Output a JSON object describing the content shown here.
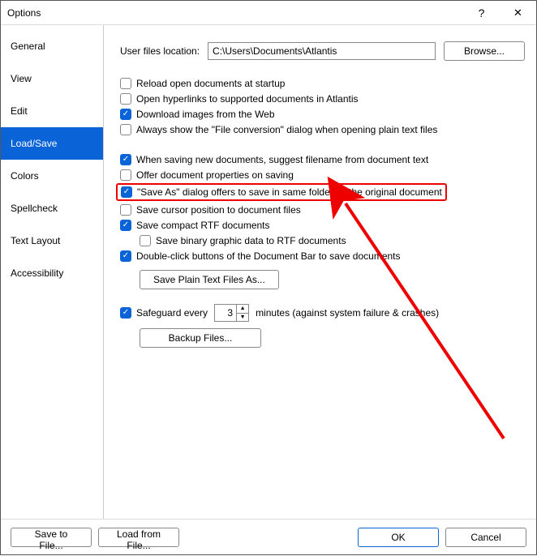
{
  "window": {
    "title": "Options"
  },
  "sidebar": {
    "tabs": [
      {
        "label": "General"
      },
      {
        "label": "View"
      },
      {
        "label": "Edit"
      },
      {
        "label": "Load/Save"
      },
      {
        "label": "Colors"
      },
      {
        "label": "Spellcheck"
      },
      {
        "label": "Text Layout"
      },
      {
        "label": "Accessibility"
      }
    ],
    "selected_index": 3
  },
  "content": {
    "files_location_label": "User files location:",
    "files_location_value": "C:\\Users\\Documents\\Atlantis",
    "browse_label": "Browse...",
    "group1": {
      "reload": "Reload open documents at startup",
      "open_hyperlinks": "Open hyperlinks to supported documents in Atlantis",
      "download_images": "Download images from the Web",
      "file_conversion": "Always show the \"File conversion\" dialog when opening plain text files"
    },
    "group2": {
      "suggest_filename": "When saving new documents, suggest filename from document text",
      "offer_props": "Offer document properties on saving",
      "save_as_same_folder": "\"Save As\" dialog offers to save in same folder as the original document",
      "save_cursor": "Save cursor position to document files",
      "save_compact_rtf": "Save compact RTF documents",
      "save_binary_graphic": "Save binary graphic data to RTF documents",
      "double_click_docbar": "Double-click buttons of the Document Bar to save documents",
      "save_plain_text_btn": "Save Plain Text Files As..."
    },
    "safeguard": {
      "label_prefix": "Safeguard every",
      "value": "3",
      "label_suffix": "minutes (against system failure & crashes)",
      "backup_btn": "Backup Files..."
    }
  },
  "footer": {
    "save_to_file": "Save to File...",
    "load_from_file": "Load from File...",
    "ok": "OK",
    "cancel": "Cancel"
  }
}
